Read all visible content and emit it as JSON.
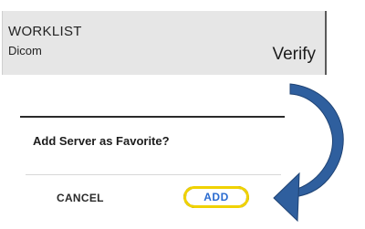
{
  "worklist": {
    "title": "WORKLIST",
    "subtitle": "Dicom",
    "action": "Verify"
  },
  "dialog": {
    "question": "Add Server as Favorite?",
    "cancel_label": "CANCEL",
    "add_label": "ADD"
  },
  "annotation": {
    "arrow_color": "#2f5f9e",
    "highlight_color": "#f0d200",
    "add_label_color": "#2a6bd0",
    "icon": "curved-arrow-icon"
  }
}
